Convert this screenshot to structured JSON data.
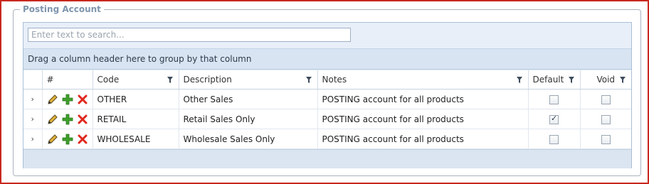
{
  "panel": {
    "title": "Posting Account"
  },
  "search": {
    "placeholder": "Enter text to search..."
  },
  "group_panel": {
    "text": "Drag a column header here to group by that column"
  },
  "columns": {
    "num": "#",
    "code": "Code",
    "description": "Description",
    "notes": "Notes",
    "default": "Default",
    "void": "Void"
  },
  "rows": [
    {
      "expander": "›",
      "code": "OTHER",
      "description": "Other Sales",
      "notes": "POSTING account for all products",
      "default": false,
      "void": false
    },
    {
      "expander": "›",
      "code": "RETAIL",
      "description": "Retail Sales Only",
      "notes": "POSTING account for all products",
      "default": true,
      "void": false
    },
    {
      "expander": "›",
      "code": "WHOLESALE",
      "description": "Wholesale Sales Only",
      "notes": "POSTING account for all products",
      "default": false,
      "void": false
    }
  ],
  "colors": {
    "border_accent": "#c8281e",
    "legend": "#7f95ad",
    "grid_header": "#d8e4f2"
  },
  "icons": {
    "edit": "pencil-icon",
    "add": "plus-icon",
    "delete": "x-icon",
    "filter": "filter-icon",
    "expand": "chevron-right-icon"
  }
}
